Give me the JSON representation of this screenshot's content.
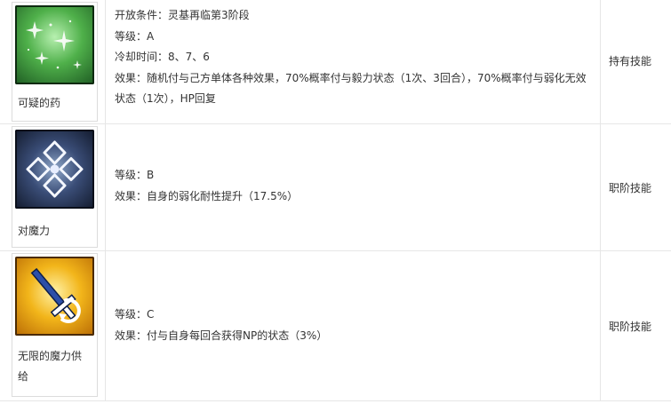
{
  "rows": [
    {
      "skill_name": "可疑的药",
      "icon": "green-sparkle-potion-icon",
      "lines": [
        "开放条件：灵基再临第3阶段",
        "等级：A",
        "冷却时间：8、7、6",
        "效果：随机付与己方单体各种效果，70%概率付与毅力状态（1次、3回合），70%概率付与弱化无效状态（1次），HP回复"
      ],
      "type": "持有技能"
    },
    {
      "skill_name": "对魔力",
      "icon": "anti-magic-diamond-icon",
      "lines": [
        "等级：B",
        "效果：自身的弱化耐性提升（17.5%）"
      ],
      "type": "职阶技能"
    },
    {
      "skill_name": "无限的魔力供给",
      "icon": "sword-np-charge-icon",
      "lines": [
        "等级：C",
        "效果：付与自身每回合获得NP的状态（3%）"
      ],
      "type": "职阶技能"
    }
  ],
  "colors": {
    "border": "#e6e6e6",
    "text": "#333333",
    "icon1": "#4fb04a",
    "icon2": "#3a4d77",
    "icon3": "#f2b51a"
  }
}
